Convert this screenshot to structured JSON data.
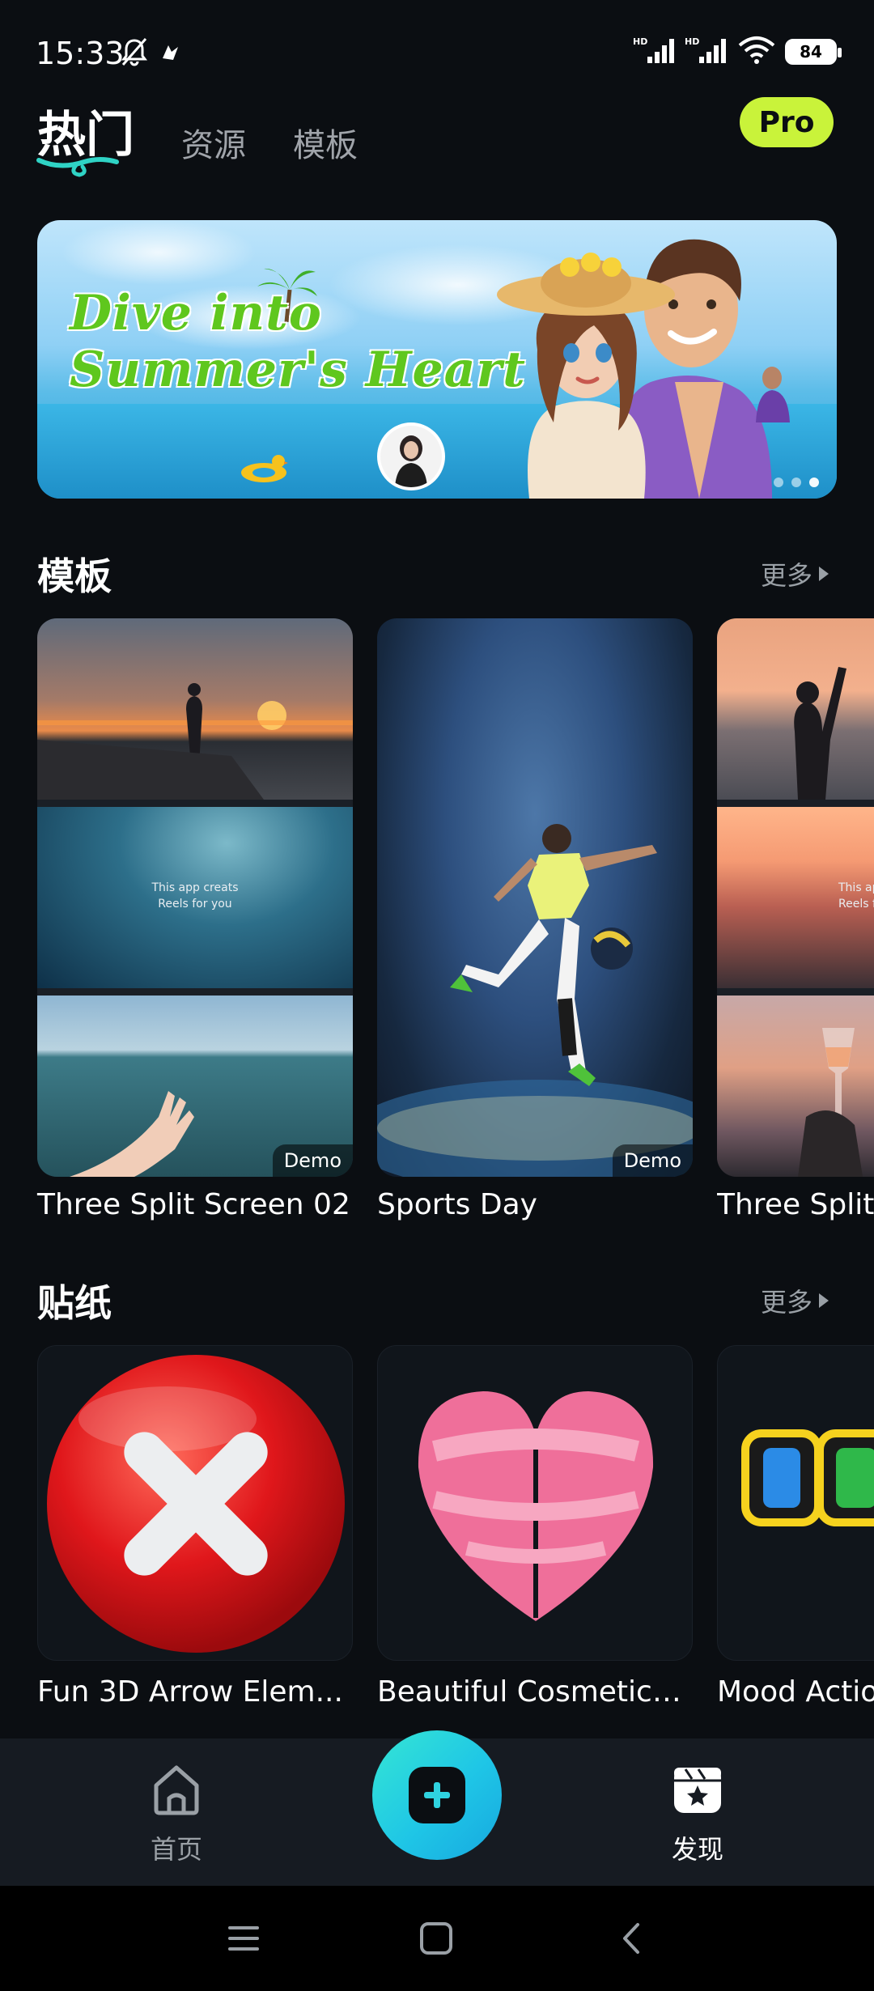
{
  "status_bar": {
    "time": "15:33",
    "battery": "84",
    "signal_1_label": "HD",
    "signal_2_label": "HD"
  },
  "top_tabs": [
    {
      "label": "热门",
      "active": true
    },
    {
      "label": "资源",
      "active": false
    },
    {
      "label": "模板",
      "active": false
    }
  ],
  "pro_badge": "Pro",
  "banner": {
    "title_line_1": "Dive into",
    "title_line_2": "Summer's Heart",
    "page_count": 3,
    "active_page": 3
  },
  "templates_section": {
    "title": "模板",
    "more": "更多",
    "items": [
      {
        "title": "Three Split Screen 02",
        "badge": "Demo",
        "caption": "This app creats Reels for you"
      },
      {
        "title": "Sports Day",
        "badge": "Demo"
      },
      {
        "title": "Three Split S",
        "caption": "This app Reels f"
      }
    ]
  },
  "stickers_section": {
    "title": "贴纸",
    "more": "更多",
    "items": [
      {
        "title": "Fun 3D Arrow Elem..."
      },
      {
        "title": "Beautiful Cosmetics..."
      },
      {
        "title": "Mood Action"
      }
    ]
  },
  "bottom_nav": {
    "home_label": "首页",
    "discover_label": "发现",
    "active": "发现"
  },
  "colors": {
    "background": "#0b0e12",
    "accent_teal": "#1fc6e6",
    "pro_green": "#c9f33a"
  }
}
